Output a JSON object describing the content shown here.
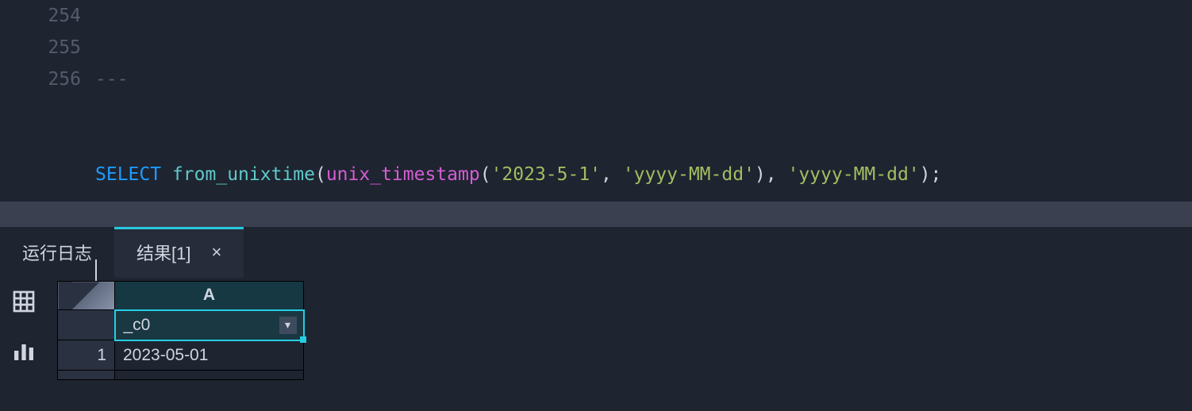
{
  "editor": {
    "lines": [
      "254",
      "255",
      "256"
    ],
    "line254": "---",
    "sql": {
      "kw_select": "SELECT",
      "fn_from_unixtime": "from_unixtime",
      "paren_open1": "(",
      "fn_unix_timestamp": "unix_timestamp",
      "paren_open2": "(",
      "arg_date": "'2023-5-1'",
      "comma1": ", ",
      "arg_fmt1": "'yyyy-MM-dd'",
      "paren_close2": ")",
      "comma2": ", ",
      "arg_fmt2": "'yyyy-MM-dd'",
      "paren_close1": ")",
      "semicolon": ";"
    }
  },
  "tabs": {
    "run_log": "运行日志",
    "results": "结果[1]",
    "close_glyph": "×"
  },
  "result_grid": {
    "col_letter": "A",
    "field_name": "_c0",
    "row_number": "1",
    "cell_value": "2023-05-01",
    "chevron_glyph": "▾"
  }
}
